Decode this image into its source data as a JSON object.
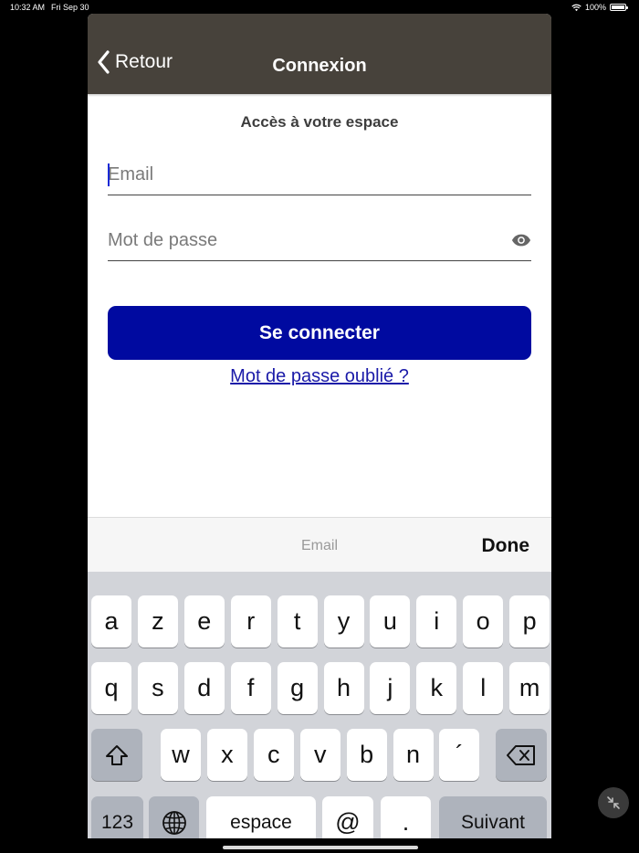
{
  "status_bar": {
    "time": "10:32 AM",
    "date": "Fri Sep 30",
    "battery": "100%",
    "battery_level": 1.0
  },
  "nav": {
    "back_label": "Retour",
    "title": "Connexion"
  },
  "form": {
    "heading": "Accès à votre espace",
    "email_placeholder": "Email",
    "email_value": "",
    "password_placeholder": "Mot de passe",
    "login_label": "Se connecter",
    "forgot_label": "Mot de passe oublié ?"
  },
  "keyboard": {
    "accessory_hint": "Email",
    "done_label": "Done",
    "row1": [
      "a",
      "z",
      "e",
      "r",
      "t",
      "y",
      "u",
      "i",
      "o",
      "p"
    ],
    "row2": [
      "q",
      "s",
      "d",
      "f",
      "g",
      "h",
      "j",
      "k",
      "l",
      "m"
    ],
    "row3": [
      "w",
      "x",
      "c",
      "v",
      "b",
      "n",
      "´"
    ],
    "numbers_label": "123",
    "space_label": "espace",
    "at_label": "@",
    "dot_label": ".",
    "next_label": "Suivant"
  }
}
